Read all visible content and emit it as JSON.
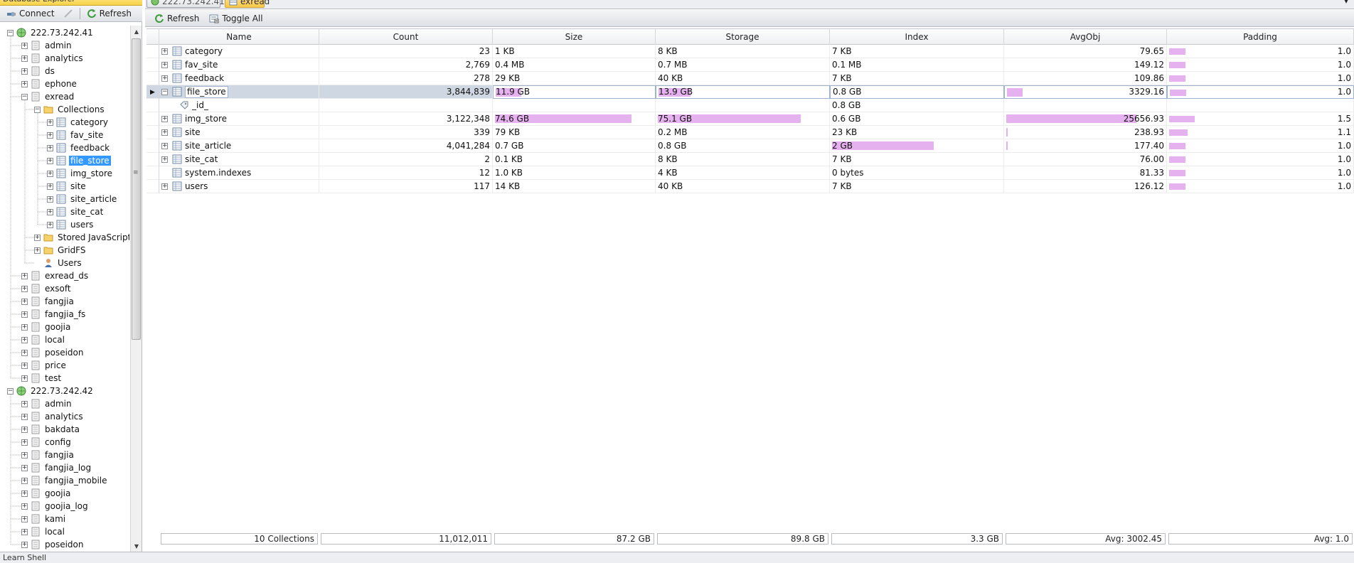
{
  "left_panel": {
    "title": "Database Explorer",
    "toolbar": {
      "connect": "Connect",
      "refresh": "Refresh"
    },
    "tree": [
      {
        "label": "222.73.242.41",
        "level": 0,
        "type": "server",
        "toggle": "-"
      },
      {
        "label": "admin",
        "level": 1,
        "type": "db",
        "toggle": "+"
      },
      {
        "label": "analytics",
        "level": 1,
        "type": "db",
        "toggle": "+"
      },
      {
        "label": "ds",
        "level": 1,
        "type": "db",
        "toggle": "+"
      },
      {
        "label": "ephone",
        "level": 1,
        "type": "db",
        "toggle": "+"
      },
      {
        "label": "exread",
        "level": 1,
        "type": "db",
        "toggle": "-"
      },
      {
        "label": "Collections",
        "level": 2,
        "type": "folder",
        "toggle": "-"
      },
      {
        "label": "category",
        "level": 3,
        "type": "collection",
        "toggle": "+"
      },
      {
        "label": "fav_site",
        "level": 3,
        "type": "collection",
        "toggle": "+"
      },
      {
        "label": "feedback",
        "level": 3,
        "type": "collection",
        "toggle": "+"
      },
      {
        "label": "file_store",
        "level": 3,
        "type": "collection",
        "toggle": "+",
        "selected": true
      },
      {
        "label": "img_store",
        "level": 3,
        "type": "collection",
        "toggle": "+"
      },
      {
        "label": "site",
        "level": 3,
        "type": "collection",
        "toggle": "+"
      },
      {
        "label": "site_article",
        "level": 3,
        "type": "collection",
        "toggle": "+"
      },
      {
        "label": "site_cat",
        "level": 3,
        "type": "collection",
        "toggle": "+"
      },
      {
        "label": "users",
        "level": 3,
        "type": "collection",
        "toggle": "+"
      },
      {
        "label": "Stored JavaScript",
        "level": 2,
        "type": "folder",
        "toggle": "+"
      },
      {
        "label": "GridFS",
        "level": 2,
        "type": "folder",
        "toggle": "+"
      },
      {
        "label": "Users",
        "level": 2,
        "type": "user",
        "toggle": ""
      },
      {
        "label": "exread_ds",
        "level": 1,
        "type": "db",
        "toggle": "+"
      },
      {
        "label": "exsoft",
        "level": 1,
        "type": "db",
        "toggle": "+"
      },
      {
        "label": "fangjia",
        "level": 1,
        "type": "db",
        "toggle": "+"
      },
      {
        "label": "fangjia_fs",
        "level": 1,
        "type": "db",
        "toggle": "+"
      },
      {
        "label": "goojia",
        "level": 1,
        "type": "db",
        "toggle": "+"
      },
      {
        "label": "local",
        "level": 1,
        "type": "db",
        "toggle": "+"
      },
      {
        "label": "poseidon",
        "level": 1,
        "type": "db",
        "toggle": "+"
      },
      {
        "label": "price",
        "level": 1,
        "type": "db",
        "toggle": "+"
      },
      {
        "label": "test",
        "level": 1,
        "type": "db",
        "toggle": "+"
      },
      {
        "label": "222.73.242.42",
        "level": 0,
        "type": "server",
        "toggle": "-"
      },
      {
        "label": "admin",
        "level": 1,
        "type": "db",
        "toggle": "+"
      },
      {
        "label": "analytics",
        "level": 1,
        "type": "db",
        "toggle": "+"
      },
      {
        "label": "bakdata",
        "level": 1,
        "type": "db",
        "toggle": "+"
      },
      {
        "label": "config",
        "level": 1,
        "type": "db",
        "toggle": "+"
      },
      {
        "label": "fangjia",
        "level": 1,
        "type": "db",
        "toggle": "+"
      },
      {
        "label": "fangjia_log",
        "level": 1,
        "type": "db",
        "toggle": "+"
      },
      {
        "label": "fangjia_mobile",
        "level": 1,
        "type": "db",
        "toggle": "+"
      },
      {
        "label": "goojia",
        "level": 1,
        "type": "db",
        "toggle": "+"
      },
      {
        "label": "goojia_log",
        "level": 1,
        "type": "db",
        "toggle": "+"
      },
      {
        "label": "kami",
        "level": 1,
        "type": "db",
        "toggle": "+"
      },
      {
        "label": "local",
        "level": 1,
        "type": "db",
        "toggle": "+"
      },
      {
        "label": "poseidon",
        "level": 1,
        "type": "db",
        "toggle": "+"
      }
    ]
  },
  "tabs": [
    {
      "label": "222.73.242.41",
      "active": false
    },
    {
      "label": "exread",
      "active": true
    }
  ],
  "main_toolbar": {
    "refresh": "Refresh",
    "toggle_all": "Toggle All"
  },
  "grid": {
    "columns": [
      "Name",
      "Count",
      "Size",
      "Storage",
      "Index",
      "AvgObj",
      "Padding"
    ],
    "rows": [
      {
        "name": "category",
        "count": "23",
        "size": "1 KB",
        "storage": "8 KB",
        "index": "7 KB",
        "avgobj": "79.65",
        "padding": "1.0",
        "expand": "+",
        "bars": {
          "size": 0,
          "storage": 0,
          "index": 0,
          "avgobj": 0,
          "padding": 0.09
        }
      },
      {
        "name": "fav_site",
        "count": "2,769",
        "size": "0.4 MB",
        "storage": "0.7 MB",
        "index": "0.1 MB",
        "avgobj": "149.12",
        "padding": "1.0",
        "expand": "+",
        "bars": {
          "size": 0,
          "storage": 0,
          "index": 0,
          "avgobj": 0,
          "padding": 0.09
        }
      },
      {
        "name": "feedback",
        "count": "278",
        "size": "29 KB",
        "storage": "40 KB",
        "index": "7 KB",
        "avgobj": "109.86",
        "padding": "1.0",
        "expand": "+",
        "bars": {
          "size": 0,
          "storage": 0,
          "index": 0,
          "avgobj": 0,
          "padding": 0.09
        }
      },
      {
        "name": "file_store",
        "count": "3,844,839",
        "size": "11.9 GB",
        "storage": "13.9 GB",
        "index": "0.8 GB",
        "avgobj": "3329.16",
        "padding": "1.0",
        "expand": "-",
        "selected": true,
        "bars": {
          "size": 0.16,
          "storage": 0.19,
          "index": 0,
          "avgobj": 0.1,
          "padding": 0.09
        }
      },
      {
        "name": "_id_",
        "count": "",
        "size": "",
        "storage": "",
        "index": "0.8 GB",
        "avgobj": "",
        "padding": "",
        "expand": "",
        "child": true,
        "bars": {
          "size": 0,
          "storage": 0,
          "index": 0,
          "avgobj": 0,
          "padding": 0
        }
      },
      {
        "name": "img_store",
        "count": "3,122,348",
        "size": "74.6 GB",
        "storage": "75.1 GB",
        "index": "0.6 GB",
        "avgobj": "25656.93",
        "padding": "1.5",
        "expand": "+",
        "bars": {
          "size": 0.86,
          "storage": 0.84,
          "index": 0,
          "avgobj": 0.82,
          "padding": 0.14
        }
      },
      {
        "name": "site",
        "count": "339",
        "size": "79 KB",
        "storage": "0.2 MB",
        "index": "23 KB",
        "avgobj": "238.93",
        "padding": "1.1",
        "expand": "+",
        "bars": {
          "size": 0,
          "storage": 0,
          "index": 0,
          "avgobj": 0.01,
          "padding": 0.1
        }
      },
      {
        "name": "site_article",
        "count": "4,041,284",
        "size": "0.7 GB",
        "storage": "0.8 GB",
        "index": "2 GB",
        "avgobj": "177.40",
        "padding": "1.0",
        "expand": "+",
        "bars": {
          "size": 0,
          "storage": 0,
          "index": 0.6,
          "avgobj": 0.01,
          "padding": 0.09
        }
      },
      {
        "name": "site_cat",
        "count": "2",
        "size": "0.1 KB",
        "storage": "8 KB",
        "index": "7 KB",
        "avgobj": "76.00",
        "padding": "1.0",
        "expand": "+",
        "bars": {
          "size": 0,
          "storage": 0,
          "index": 0,
          "avgobj": 0,
          "padding": 0.09
        }
      },
      {
        "name": "system.indexes",
        "count": "12",
        "size": "1.0 KB",
        "storage": "4 KB",
        "index": "0 bytes",
        "avgobj": "81.33",
        "padding": "1.0",
        "expand": "",
        "bars": {
          "size": 0,
          "storage": 0,
          "index": 0,
          "avgobj": 0,
          "padding": 0.09
        }
      },
      {
        "name": "users",
        "count": "117",
        "size": "14 KB",
        "storage": "40 KB",
        "index": "7 KB",
        "avgobj": "126.12",
        "padding": "1.0",
        "expand": "+",
        "bars": {
          "size": 0,
          "storage": 0,
          "index": 0,
          "avgobj": 0,
          "padding": 0.09
        }
      }
    ],
    "footer": {
      "collections": "10 Collections",
      "count": "11,012,011",
      "size": "87.2 GB",
      "storage": "89.8 GB",
      "index": "3.3 GB",
      "avgobj": "Avg: 3002.45",
      "padding": "Avg: 1.0"
    }
  },
  "status_bar": "Learn Shell",
  "colors": {
    "accent": "#3399ff",
    "bar": "#e5b2ef",
    "tab_active": "#f9c84a"
  }
}
